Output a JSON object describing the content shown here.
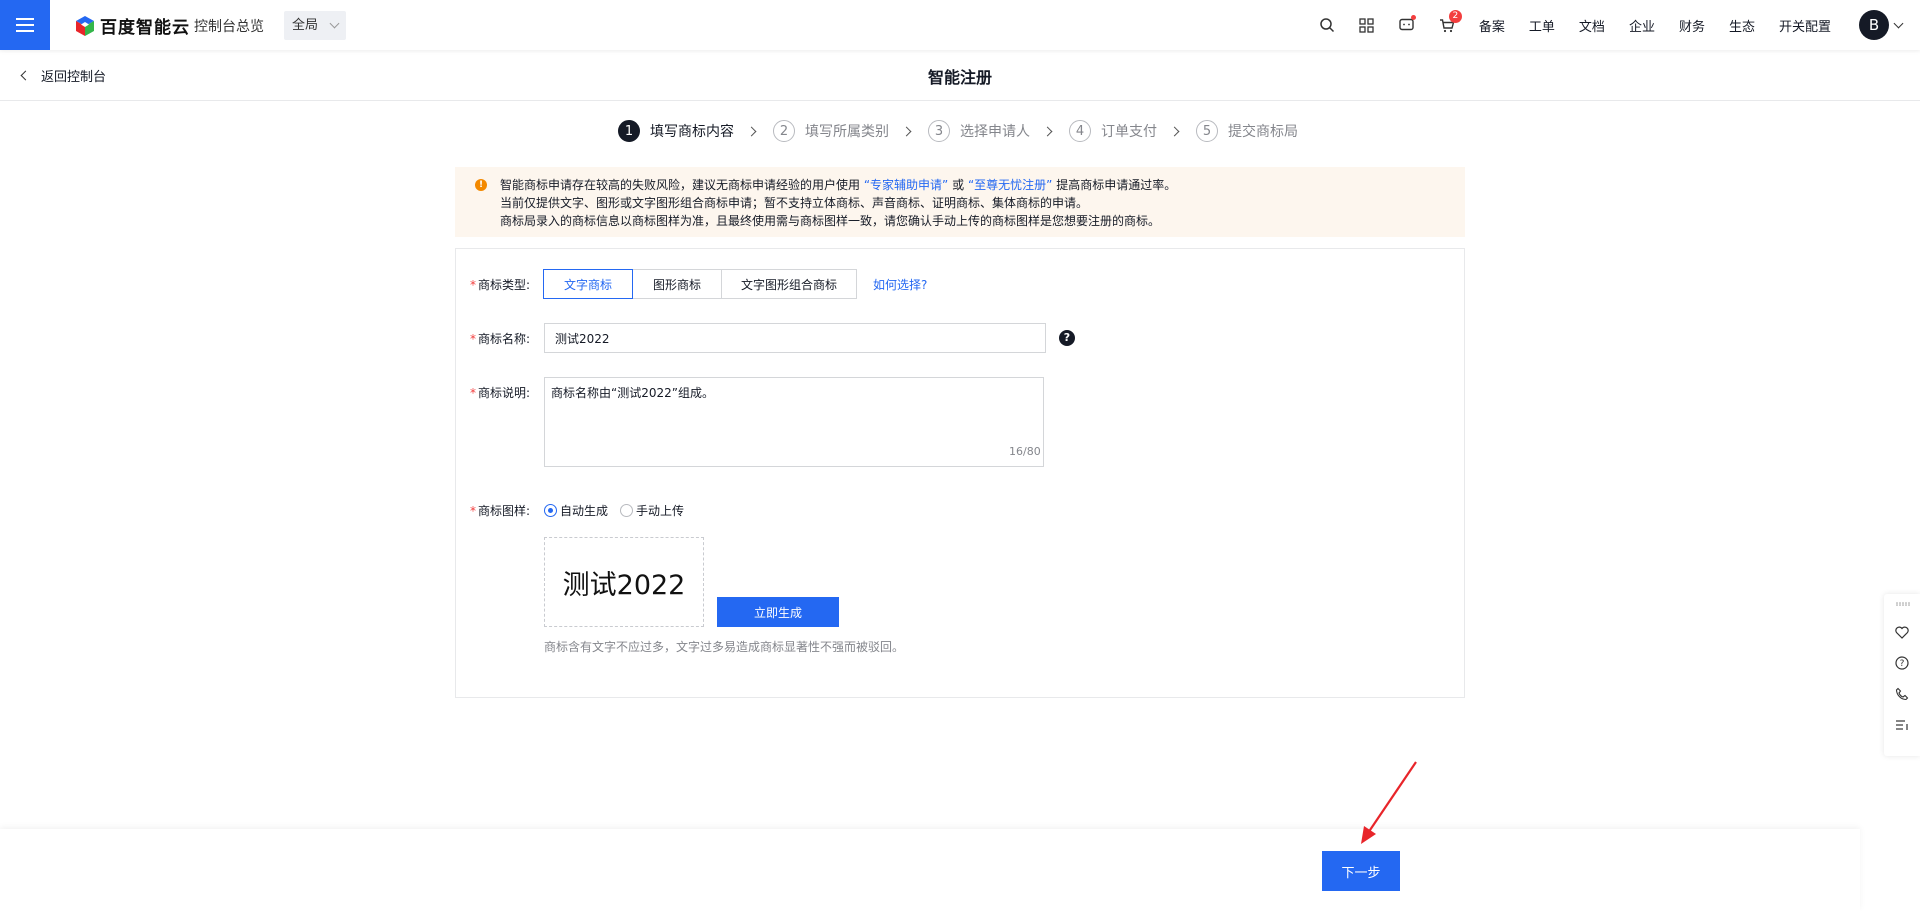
{
  "topbar": {
    "logo_text": "百度智能云",
    "console_label": "控制台总览",
    "scope": "全局",
    "cart_badge": "2",
    "nav_items": [
      "备案",
      "工单",
      "文档",
      "企业",
      "财务",
      "生态",
      "开关配置"
    ],
    "avatar_letter": "B"
  },
  "subheader": {
    "back_label": "返回控制台",
    "title": "智能注册"
  },
  "steps": [
    {
      "num": "1",
      "label": "填写商标内容"
    },
    {
      "num": "2",
      "label": "填写所属类别"
    },
    {
      "num": "3",
      "label": "选择申请人"
    },
    {
      "num": "4",
      "label": "订单支付"
    },
    {
      "num": "5",
      "label": "提交商标局"
    }
  ],
  "notice": {
    "line1_pre": "智能商标申请存在较高的失败风险，建议无商标申请经验的用户使用",
    "link1": "“专家辅助申请”",
    "mid": "或",
    "link2": "“至尊无忧注册”",
    "line1_post": "提高商标申请通过率。",
    "line2": "当前仅提供文字、图形或文字图形组合商标申请；暂不支持立体商标、声音商标、证明商标、集体商标的申请。",
    "line3": "商标局录入的商标信息以商标图样为准，且最终使用需与商标图样一致，请您确认手动上传的商标图样是您想要注册的商标。"
  },
  "form": {
    "type_label": "商标类型:",
    "types": [
      "文字商标",
      "图形商标",
      "文字图形组合商标"
    ],
    "how_link": "如何选择?",
    "name_label": "商标名称:",
    "name_value": "测试2022",
    "desc_label": "商标说明:",
    "desc_value": "商标名称由“测试2022”组成。",
    "desc_counter": "16/80",
    "image_label": "商标图样:",
    "radio_auto": "自动生成",
    "radio_manual": "手动上传",
    "preview_text": "测试2022",
    "generate_label": "立即生成",
    "hint": "商标含有文字不应过多，文字过多易造成商标显著性不强而被驳回。"
  },
  "footer": {
    "next_label": "下一步"
  },
  "colors": {
    "primary": "#2468f2",
    "warning": "#f38900",
    "notice_bg": "#fdf6ee",
    "annotation_arrow": "#e8252a"
  }
}
